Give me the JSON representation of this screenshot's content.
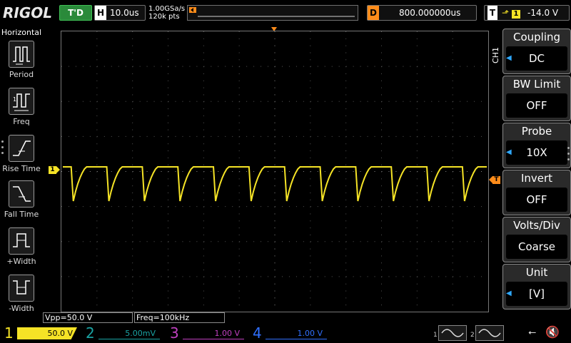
{
  "brand": "RIGOL",
  "topbar": {
    "trigger_status": "T'D",
    "horizontal_label": "H",
    "timebase": "10.0us",
    "sample_rate": "1.00GSa/s",
    "memory_depth": "120k pts",
    "delay_label": "D",
    "delay_value": "800.000000us",
    "trigger_label": "T",
    "trigger_source": "1",
    "trigger_level": "-14.0 V"
  },
  "left_menu": {
    "title": "Horizontal",
    "items": [
      {
        "label": "Period",
        "icon": "period-icon"
      },
      {
        "label": "Freq",
        "icon": "freq-icon"
      },
      {
        "label": "Rise Time",
        "icon": "rise-time-icon"
      },
      {
        "label": "Fall Time",
        "icon": "fall-time-icon"
      },
      {
        "label": "+Width",
        "icon": "pos-width-icon"
      },
      {
        "label": "-Width",
        "icon": "neg-width-icon"
      }
    ]
  },
  "screen": {
    "trigger_marker": "T",
    "channel_marker": "1",
    "trigger_level_marker": "T"
  },
  "right_menu": {
    "channel": "CH1",
    "items": [
      {
        "title": "Coupling",
        "value": "DC",
        "arrow": true
      },
      {
        "title": "BW Limit",
        "value": "OFF",
        "arrow": false
      },
      {
        "title": "Probe",
        "value": "10X",
        "arrow": true
      },
      {
        "title": "Invert",
        "value": "OFF",
        "arrow": false
      },
      {
        "title": "Volts/Div",
        "value": "Coarse",
        "arrow": false
      },
      {
        "title": "Unit",
        "value": "[V]",
        "arrow": true
      }
    ]
  },
  "measurements": {
    "vpp": "Vpp=50.0 V",
    "freq": "Freq=100kHz"
  },
  "bottom": {
    "channels": [
      {
        "num": "1",
        "value": "50.0 V",
        "color": "#f5e326"
      },
      {
        "num": "2",
        "value": "5.00mV",
        "color": "#1aa3a3"
      },
      {
        "num": "3",
        "value": "1.00 V",
        "color": "#c040c0"
      },
      {
        "num": "4",
        "value": "1.00 V",
        "color": "#3070ff"
      }
    ],
    "gen1": "1",
    "gen2": "2"
  },
  "colors": {
    "ch1": "#f5e326",
    "accent": "#2fa9ff",
    "trigger": "#ff8c1a"
  },
  "waveform": {
    "cycles": 12,
    "period_div": 1,
    "high_fraction": 0.5
  }
}
